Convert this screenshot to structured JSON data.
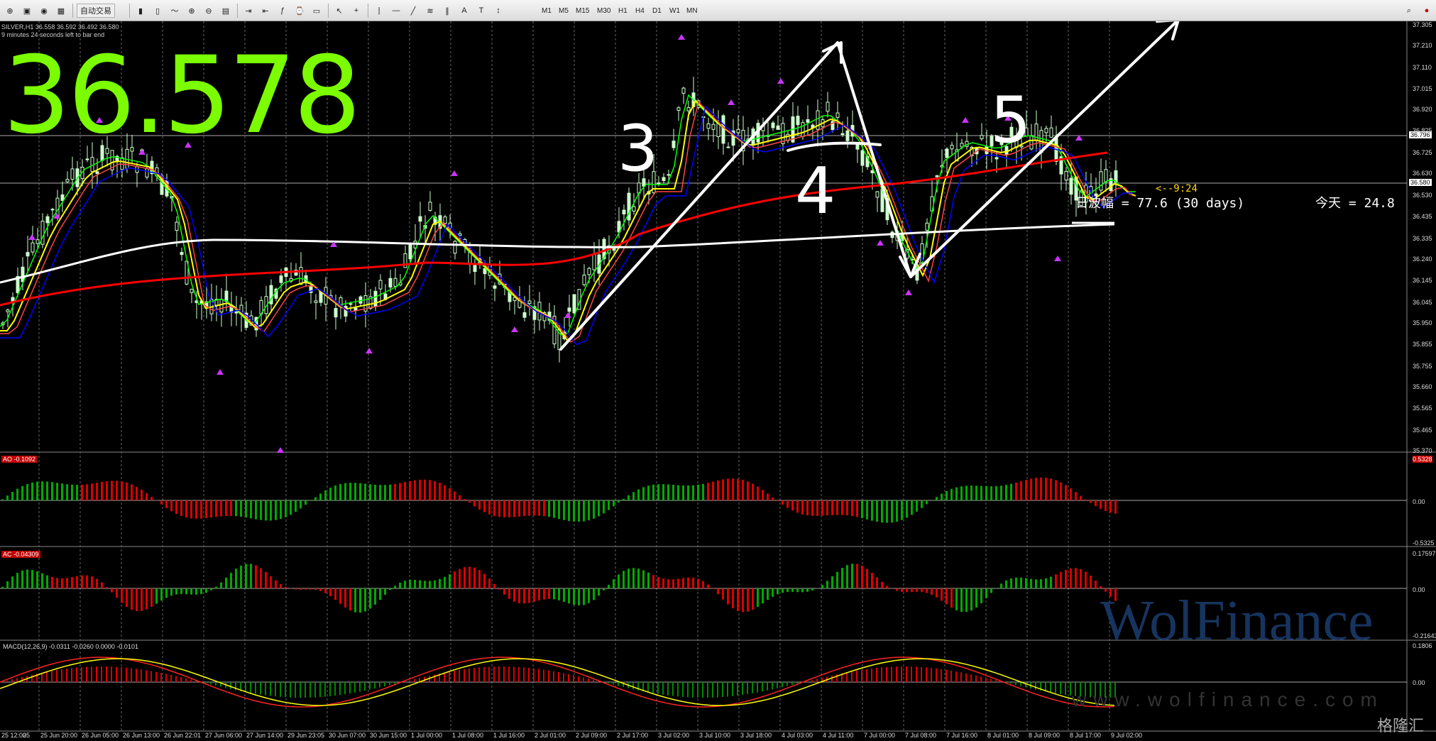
{
  "toolbar": {
    "auto_trade": "自动交易",
    "timeframes": [
      "M1",
      "M5",
      "M15",
      "M30",
      "H1",
      "H4",
      "D1",
      "W1",
      "MN"
    ],
    "icons": [
      "new-order-icon",
      "profiles-icon",
      "market-watch-icon",
      "navigator-icon",
      "auto-trade-icon",
      "bar-chart-icon",
      "candle-chart-icon",
      "line-chart-icon",
      "zoom-in-icon",
      "zoom-out-icon",
      "tile-icon",
      "autoscroll-icon",
      "chart-shift-icon",
      "indicators-icon",
      "periods-icon",
      "templates-icon",
      "cursor-icon",
      "crosshair-icon",
      "vertical-line-icon",
      "horizontal-line-icon",
      "trendline-icon",
      "fibo-icon",
      "channel-icon",
      "text-icon",
      "label-icon",
      "arrows-icon"
    ]
  },
  "chart": {
    "symbol_line": "SILVER,H1  36.558 36.592 36.492 36.580",
    "timer_line": "9 minutes 24 seconds left to bar end",
    "big_price": "36.578",
    "countdown": "<--9:24",
    "daily_range": "日波幅 = 77.6  (30 days)",
    "today_range": "今天 = 24.8",
    "current_price": "36.580",
    "ref_price": "36.796",
    "annotations": [
      "3",
      "4",
      "5"
    ],
    "colors": {
      "bull": "#ccffcc",
      "ma_white": "#ffffff",
      "ma_red": "#ff0000",
      "ma_yellow": "#ffff00",
      "ma_green": "#00ff00",
      "ma_blue": "#0000ff",
      "big_price": "#7cfc00"
    }
  },
  "price_axis": [
    "37.305",
    "37.210",
    "37.110",
    "37.015",
    "36.920",
    "36.825",
    "36.725",
    "36.630",
    "36.530",
    "36.435",
    "36.335",
    "36.240",
    "36.145",
    "36.045",
    "35.950",
    "35.855",
    "35.755",
    "35.660",
    "35.565",
    "35.465",
    "35.370"
  ],
  "time_axis": [
    "25 12:00",
    "25",
    "25 Jun 20:00",
    "26 Jun 05:00",
    "26 Jun 13:00",
    "26 Jun 22:01",
    "27 Jun 06:00",
    "27 Jun 14:00",
    "29 Jun 23:05",
    "30 Jun 07:00",
    "30 Jun 15:00",
    "1 Jul 00:00",
    "1 Jul 08:00",
    "1 Jul 16:00",
    "2 Jul 01:00",
    "2 Jul 09:00",
    "2 Jul 17:00",
    "3 Jul 02:00",
    "3 Jul 10:00",
    "3 Jul 18:00",
    "4 Jul 03:00",
    "4 Jul 11:00",
    "7 Jul 00:00",
    "7 Jul 08:00",
    "7 Jul 16:00",
    "8 Jul 01:00",
    "8 Jul 09:00",
    "8 Jul 17:00",
    "9 Jul 02:00"
  ],
  "indicators": {
    "ao": {
      "label": "AO -0.1092",
      "levels": [
        "0.5328",
        "0.00",
        "-0.5325"
      ]
    },
    "ac": {
      "label": "AC -0.04309",
      "levels": [
        "0.17597",
        "0.00",
        "-0.21643"
      ]
    },
    "macd": {
      "label": "MACD(12,26,9) -0.0311 -0.0260 0.0000 -0.0101",
      "levels": [
        "0.1806",
        "0.00"
      ]
    }
  },
  "watermark": {
    "brand": "WolFinance",
    "url": "www.wolfinance.com",
    "corner": "格隆汇"
  }
}
